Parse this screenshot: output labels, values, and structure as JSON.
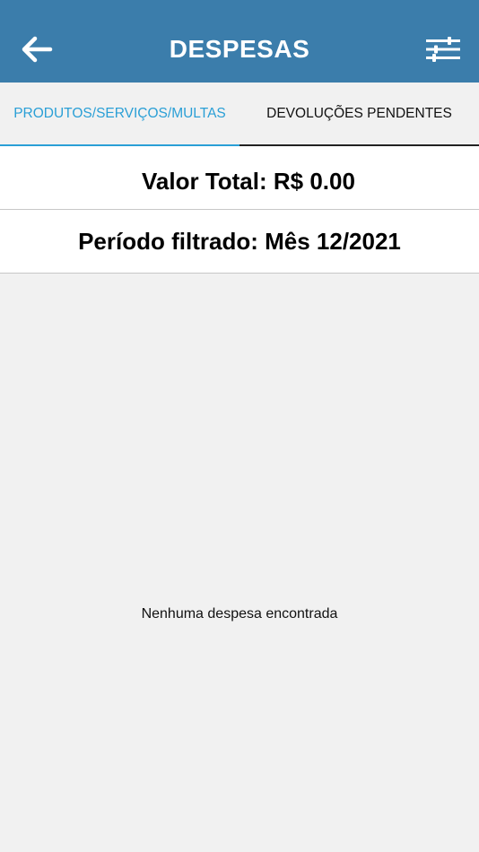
{
  "header": {
    "title": "DESPESAS",
    "back_icon": "arrow-left-icon",
    "filter_icon": "sliders-icon",
    "bg_color": "#3b7dab"
  },
  "tabs": [
    {
      "label": "PRODUTOS/SERVIÇOS/MULTAS",
      "active": true
    },
    {
      "label": "DEVOLUÇÕES PENDENTES",
      "active": false
    }
  ],
  "summary": {
    "total_label": "Valor Total: R$ 0.00",
    "period_label": "Período filtrado: Mês 12/2021"
  },
  "empty_state": {
    "message": "Nenhuma despesa encontrada"
  },
  "colors": {
    "accent": "#2a9fd6",
    "background": "#f1f1f1"
  }
}
